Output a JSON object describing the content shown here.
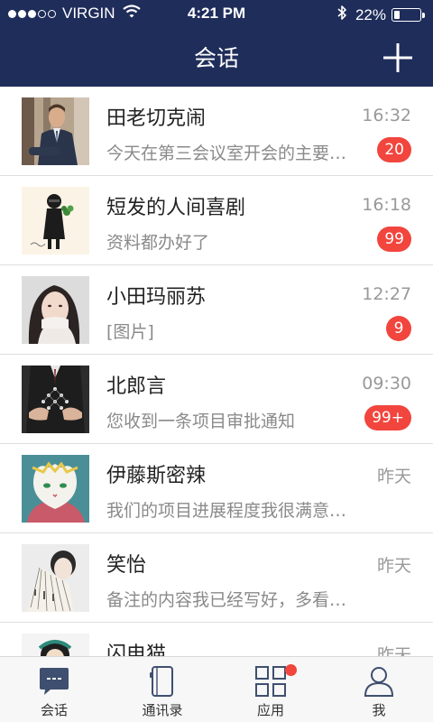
{
  "status_bar": {
    "carrier": "VIRGIN",
    "time": "4:21 PM",
    "battery_label": "22%",
    "battery_level": 0.22,
    "signal_bars_filled": 3,
    "signal_bars_total": 5
  },
  "header": {
    "title": "会话",
    "add_icon": "plus-icon"
  },
  "colors": {
    "nav_background": "#1f2d5a",
    "badge": "#f1453d",
    "divider": "#dedede"
  },
  "conversations": [
    {
      "name": "田老切克闹",
      "time": "16:32",
      "preview": "今天在第三会议室开会的主要内容是关于项目",
      "badge": "20",
      "avatar": "man-in-suit"
    },
    {
      "name": "短发的人间喜剧",
      "time": "16:18",
      "preview": "资料都办好了",
      "badge": "99",
      "avatar": "cartoon-figure-with-plant"
    },
    {
      "name": "小田玛丽苏",
      "time": "12:27",
      "preview": "[图片]",
      "badge": "9",
      "avatar": "woman-portrait"
    },
    {
      "name": "北郎言",
      "time": "09:30",
      "preview": "您收到一条项目审批通知",
      "badge": "99+",
      "avatar": "hands-network"
    },
    {
      "name": "伊藤斯密辣",
      "time": "昨天",
      "preview": "我们的项目进展程度我很满意，继续加油",
      "badge": "",
      "avatar": "illustrated-cat"
    },
    {
      "name": "笑怡",
      "time": "昨天",
      "preview": "备注的内容我已经写好，多看看吧",
      "badge": "",
      "avatar": "woman-with-fan"
    },
    {
      "name": "闪电猫",
      "time": "昨天",
      "preview": "",
      "badge": "",
      "avatar": "cartoon-character"
    }
  ],
  "tab_bar": {
    "items": [
      {
        "label": "会话",
        "icon": "chat-bubble-icon",
        "active": true
      },
      {
        "label": "通讯录",
        "icon": "contacts-book-icon",
        "active": false
      },
      {
        "label": "应用",
        "icon": "apps-grid-icon",
        "active": false,
        "has_dot": true
      },
      {
        "label": "我",
        "icon": "person-icon",
        "active": false
      }
    ]
  }
}
